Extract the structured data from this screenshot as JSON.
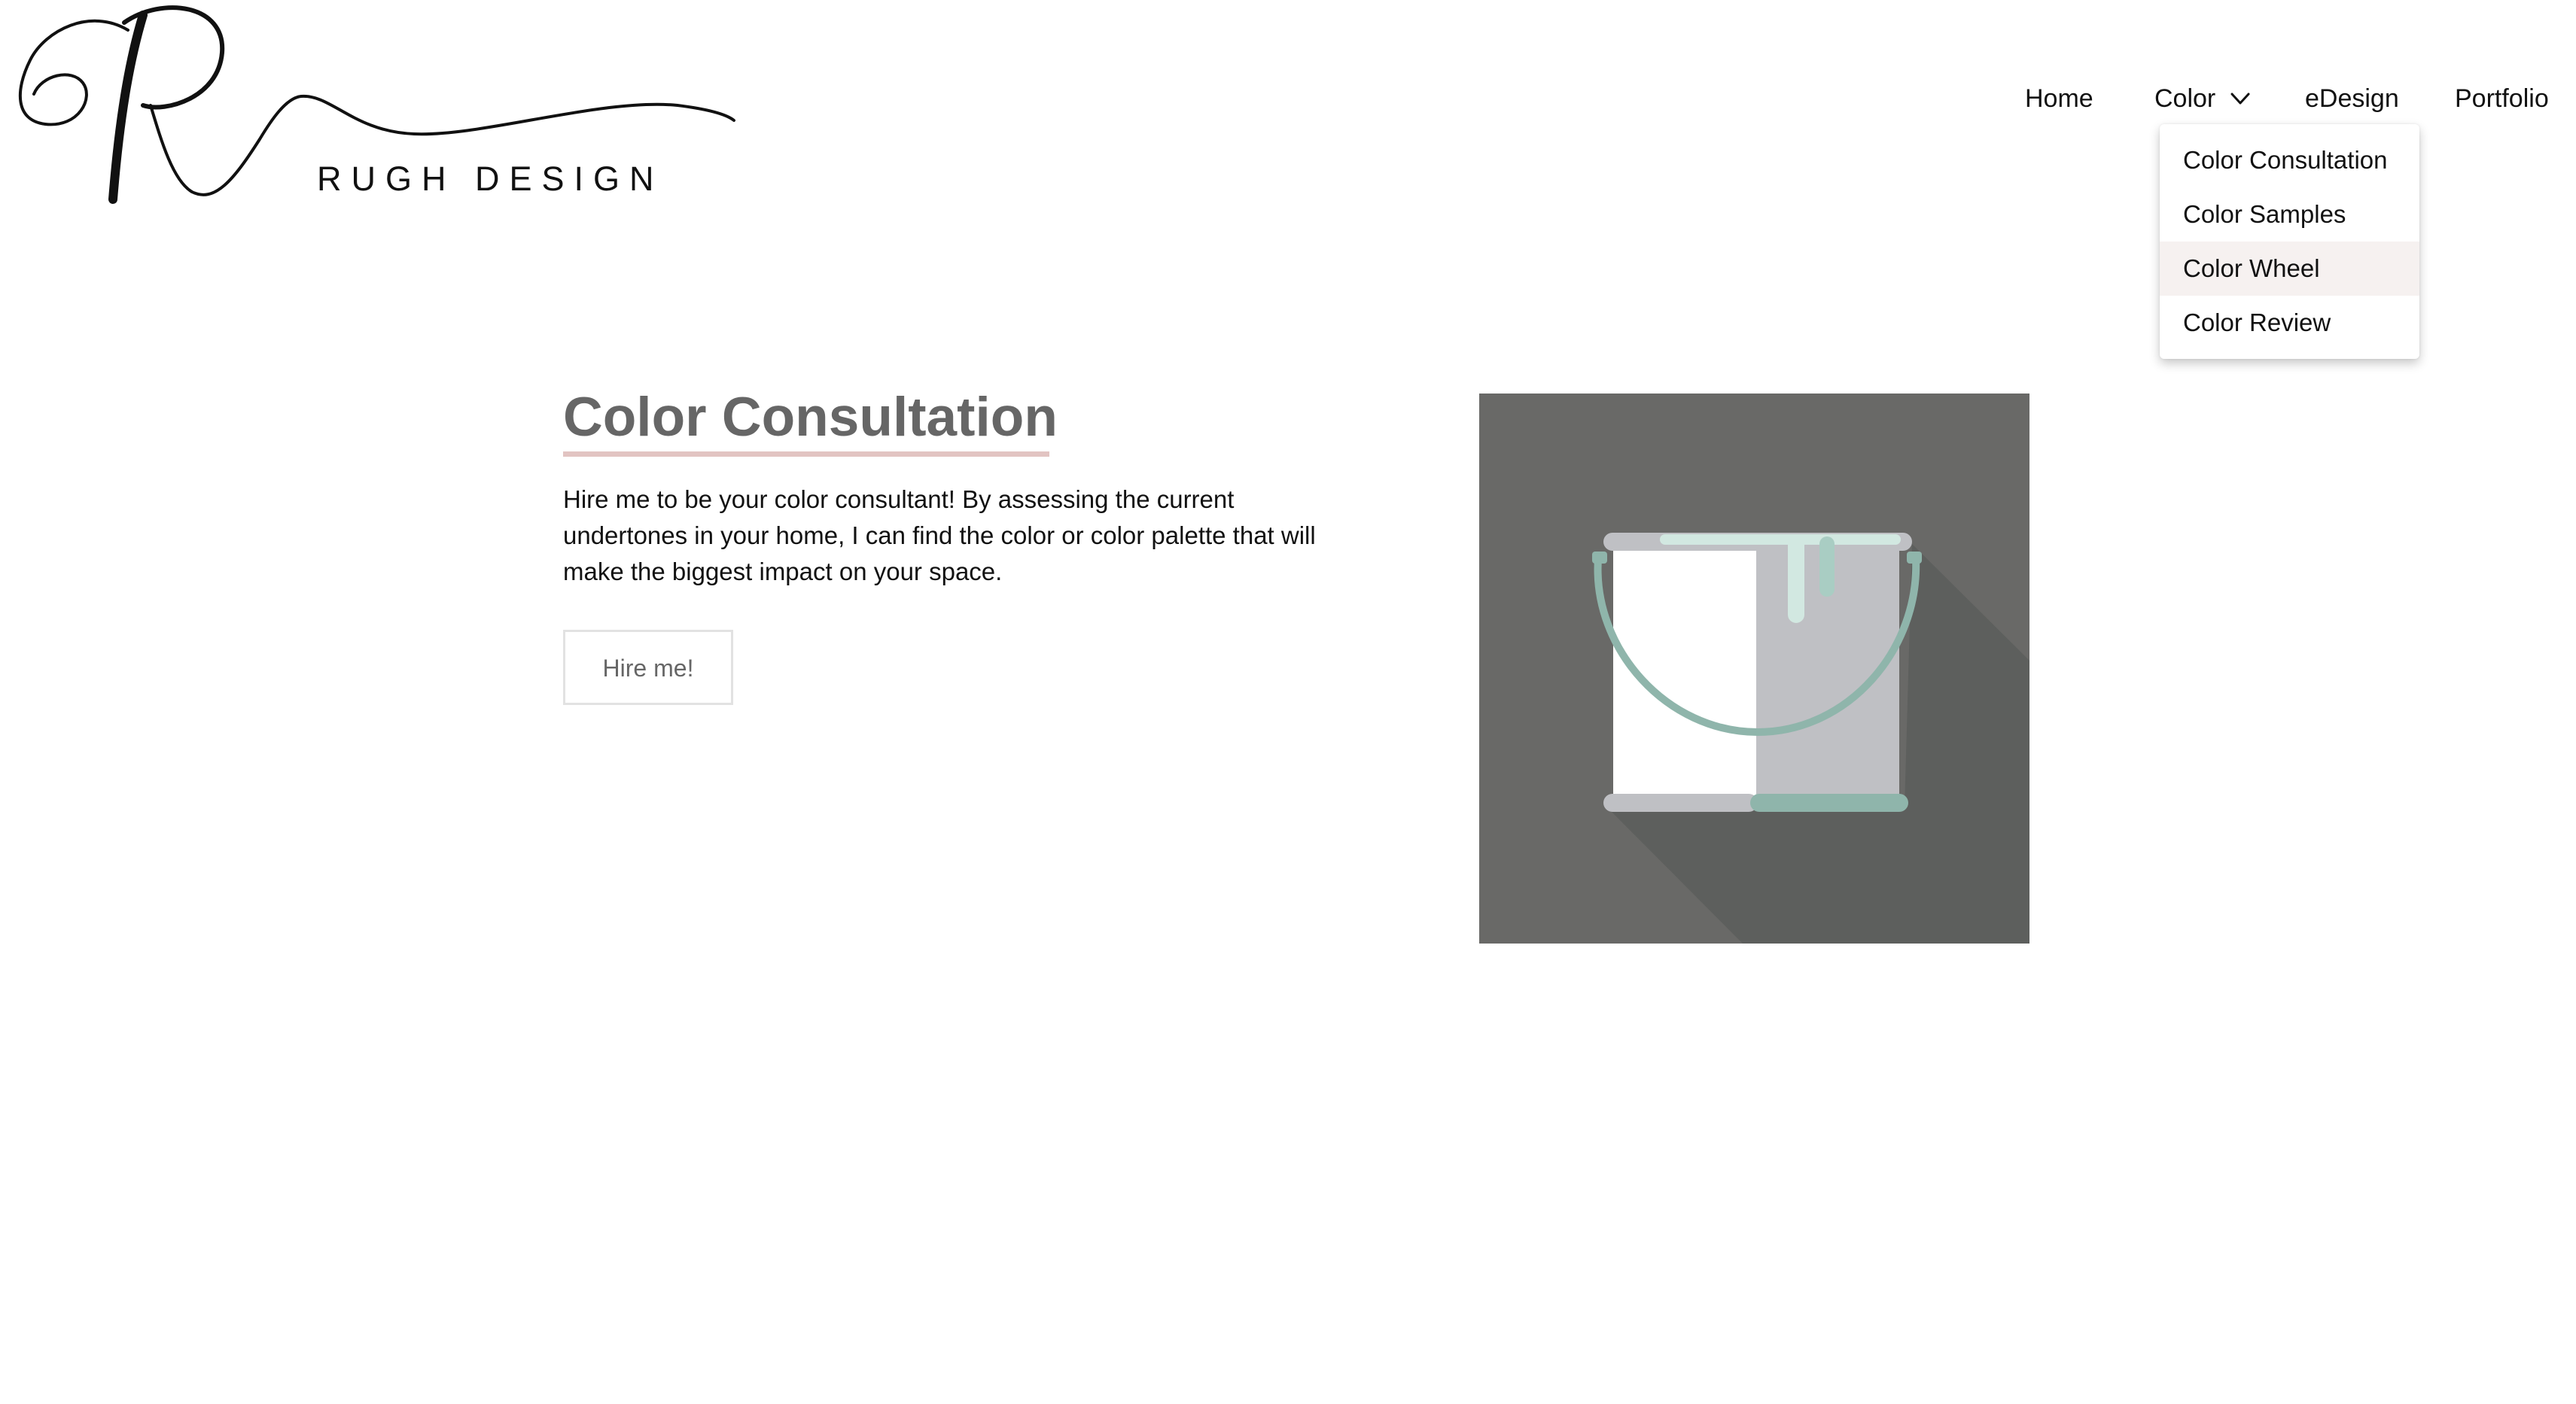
{
  "brand": {
    "logo_text": "RUGH DESIGN"
  },
  "nav": {
    "items": [
      {
        "label": "Home"
      },
      {
        "label": "Color"
      },
      {
        "label": "eDesign"
      },
      {
        "label": "Portfolio"
      }
    ],
    "dropdown": {
      "items": [
        {
          "label": "Color Consultation"
        },
        {
          "label": "Color Samples"
        },
        {
          "label": "Color Wheel",
          "hovered": true
        },
        {
          "label": "Color Review"
        }
      ]
    }
  },
  "main": {
    "title": "Color Consultation",
    "description": "Hire me to be your color consultant! By assessing the current undertones in your home, I can find the color or color palette that will make the biggest impact on your space.",
    "button_label": "Hire me!"
  },
  "colors": {
    "title": "#666666",
    "title_underline": "#e2c4c2",
    "illustration_bg": "#696967",
    "paint_mint": "#8fb5ab",
    "dropdown_hover": "#f6f1f0"
  },
  "icons": {
    "logo": "script-r-logo",
    "dropdown_chevron": "chevron-down-icon",
    "illustration": "paint-bucket-icon"
  }
}
